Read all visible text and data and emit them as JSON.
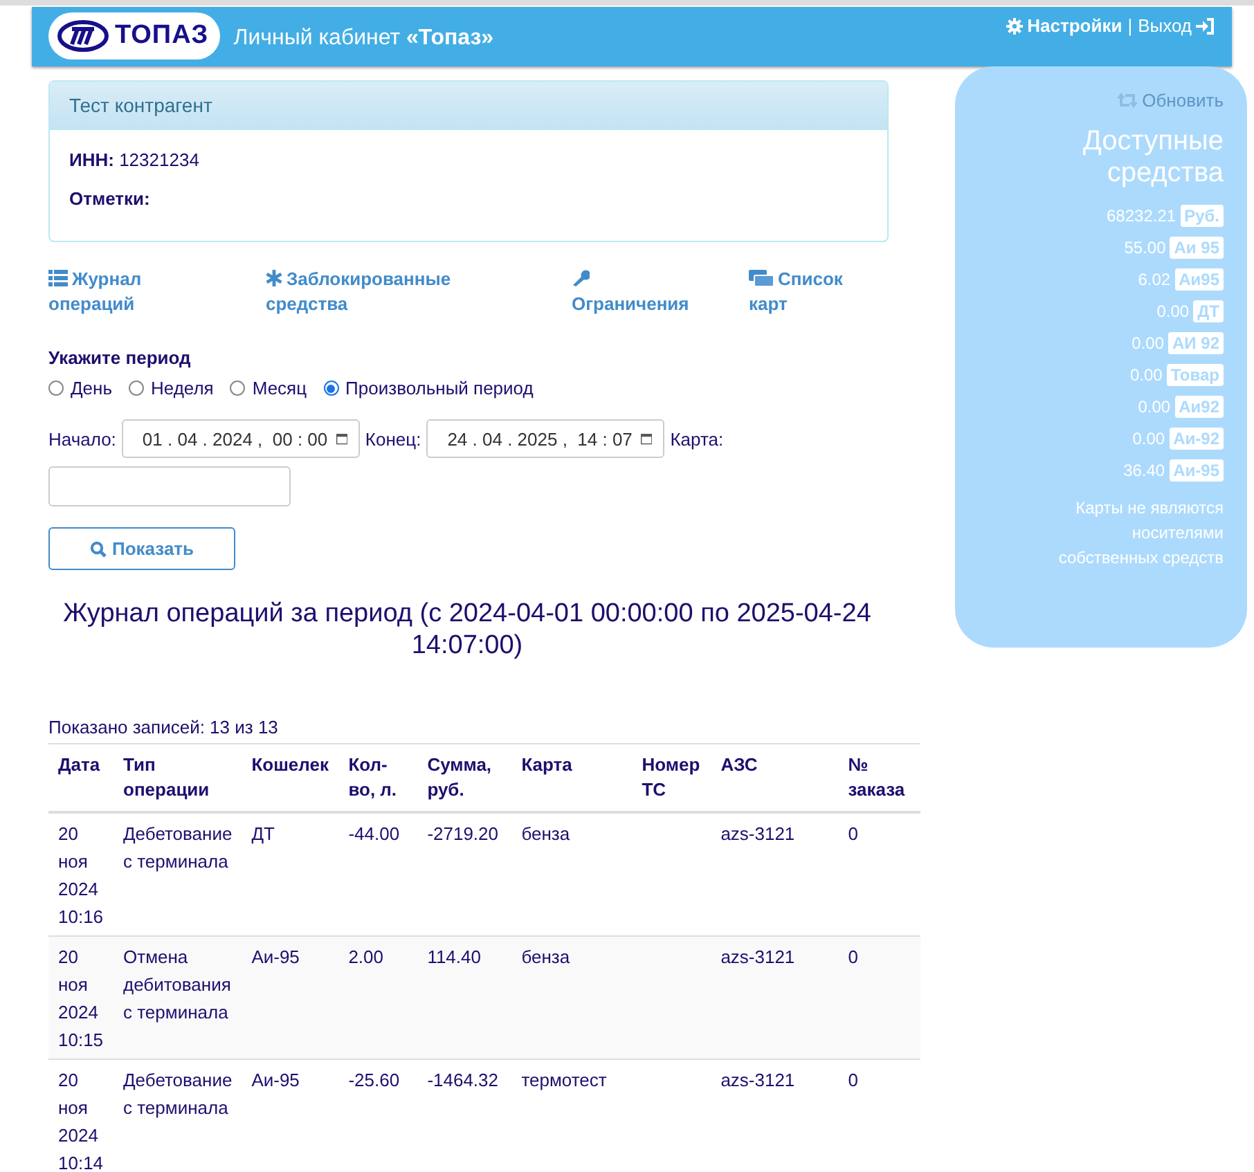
{
  "header": {
    "logo_text": "ТОПАЗ",
    "title": "Личный кабинет ",
    "title_bold": "«Топаз»",
    "settings": "Настройки",
    "separator": "|",
    "logout": "Выход"
  },
  "account": {
    "name": "Тест контрагент",
    "inn_label": "ИНН:",
    "inn": "12321234",
    "notes_label": "Отметки:"
  },
  "nav": [
    {
      "kind": "list",
      "label": "Журнал операций"
    },
    {
      "kind": "asterisk",
      "label": "Заблокированные средства"
    },
    {
      "kind": "wrench",
      "label": "Ограничения"
    },
    {
      "kind": "cards",
      "label": "Список карт"
    }
  ],
  "period": {
    "label": "Укажите период",
    "options": [
      {
        "label": "День",
        "selected": false
      },
      {
        "label": "Неделя",
        "selected": false
      },
      {
        "label": "Месяц",
        "selected": false
      },
      {
        "label": "Произвольный период",
        "selected": true
      }
    ]
  },
  "filters": {
    "start_label": "Начало:",
    "start": "01 . 04 . 2024 ,  00 : 00",
    "end_label": "Конец:",
    "end": "24 . 04 . 2025 ,  14 : 07",
    "card_label": "Карта:"
  },
  "show_button": "Показать",
  "report_title": "Журнал операций за период (с 2024-04-01 00:00:00 по 2025-04-24 14:07:00)",
  "records": "Показано записей: 13 из 13",
  "table": {
    "columns": [
      "Дата",
      "Тип операции",
      "Кошелек",
      "Кол-во, л.",
      "Сумма, руб.",
      "Карта",
      "Номер ТС",
      "АЗС",
      "№ заказа"
    ],
    "rows": [
      [
        "20 ноя 2024 10:16",
        "Дебетование с терминала",
        "ДТ",
        "-44.00",
        "-2719.20",
        "бенза",
        "",
        "azs-3121",
        "0"
      ],
      [
        "20 ноя 2024 10:15",
        "Отмена дебитования с терминала",
        "Аи-95",
        "2.00",
        "114.40",
        "бенза",
        "",
        "azs-3121",
        "0"
      ],
      [
        "20 ноя 2024 10:14",
        "Дебетование с терминала",
        "Аи-95",
        "-25.60",
        "-1464.32",
        "термотест",
        "",
        "azs-3121",
        "0"
      ]
    ]
  },
  "balance": {
    "refresh": "Обновить",
    "title": "Доступные средства",
    "items": [
      {
        "amount": "68232.21",
        "unit": "Руб."
      },
      {
        "amount": "55.00",
        "unit": "Аи 95"
      },
      {
        "amount": "6.02",
        "unit": "Аи95"
      },
      {
        "amount": "0.00",
        "unit": "ДТ"
      },
      {
        "amount": "0.00",
        "unit": "АИ 92"
      },
      {
        "amount": "0.00",
        "unit": "Товар"
      },
      {
        "amount": "0.00",
        "unit": "Аи92"
      },
      {
        "amount": "0.00",
        "unit": "Аи-92"
      },
      {
        "amount": "36.40",
        "unit": "Аи-95"
      }
    ],
    "note": "Карты не являются носителями собственных средств"
  }
}
